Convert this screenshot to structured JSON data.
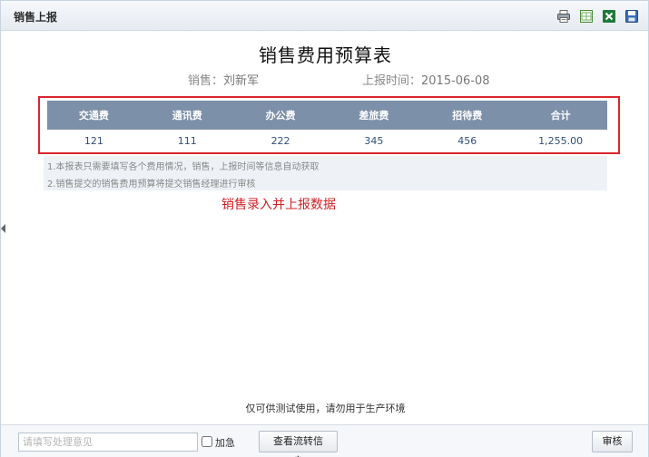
{
  "window": {
    "title": "销售上报"
  },
  "toolbar": {
    "icons": [
      "printer-icon",
      "excel-export-icon",
      "excel-icon",
      "save-icon"
    ]
  },
  "document": {
    "title": "销售费用预算表",
    "salesperson_label": "销售：",
    "salesperson_value": "刘新军",
    "report_time_label": "上报时间：",
    "report_time_value": "2015-06-08"
  },
  "table": {
    "headers": [
      "交通费",
      "通讯费",
      "办公费",
      "差旅费",
      "招待费",
      "合计"
    ],
    "row": [
      "121",
      "111",
      "222",
      "345",
      "456",
      "1,255.00"
    ]
  },
  "notes": [
    "1.本报表只需要填写各个费用情况，销售，上报时间等信息自动获取",
    "2.销售提交的销售费用预算将提交销售经理进行审核"
  ],
  "annotation": "销售录入并上报数据",
  "footer": {
    "notice": "仅可供测试使用，请勿用于生产环境"
  },
  "bottom": {
    "opinion_placeholder": "请填写处理意见",
    "urgent_label": "加急",
    "view_flow_button": "查看流转信息",
    "audit_button": "审核"
  },
  "colors": {
    "header_bg": "#7d90a9",
    "highlight_border": "#d9262c",
    "annotation": "#d02027"
  }
}
